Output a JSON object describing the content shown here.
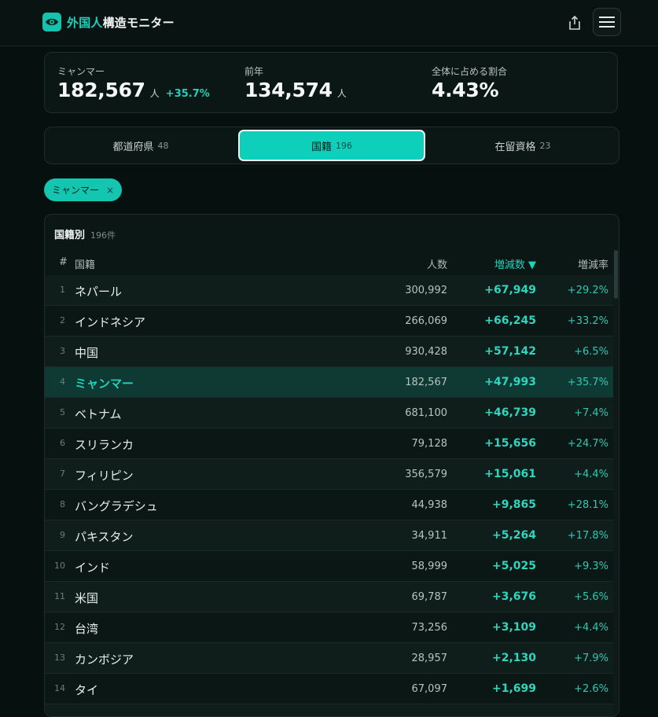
{
  "app": {
    "title_accent": "外国人",
    "title_rest": "構造モニター"
  },
  "header": {
    "share_icon": "share-icon",
    "menu_icon": "hamburger-menu-icon"
  },
  "stats": {
    "current": {
      "label": "ミャンマー",
      "value": "182,567",
      "unit": "人",
      "change": "+35.7%"
    },
    "previous": {
      "label": "前年",
      "value": "134,574",
      "unit": "人"
    },
    "share": {
      "label": "全体に占める割合",
      "value": "4.43%"
    }
  },
  "tabs": [
    {
      "label": "都道府県",
      "count": "48",
      "active": false
    },
    {
      "label": "国籍",
      "count": "196",
      "active": true
    },
    {
      "label": "在留資格",
      "count": "23",
      "active": false
    }
  ],
  "filter_chip": {
    "label": "ミャンマー",
    "close": "×"
  },
  "table": {
    "title": "国籍別",
    "count": "196件",
    "headers": {
      "rank": "#",
      "name": "国籍",
      "population": "人数",
      "delta": "増減数 ▼",
      "rate": "増減率"
    },
    "highlight_rank": "4",
    "rows": [
      {
        "rank": "1",
        "name": "ネパール",
        "population": "300,992",
        "delta": "+67,949",
        "rate": "+29.2%"
      },
      {
        "rank": "2",
        "name": "インドネシア",
        "population": "266,069",
        "delta": "+66,245",
        "rate": "+33.2%"
      },
      {
        "rank": "3",
        "name": "中国",
        "population": "930,428",
        "delta": "+57,142",
        "rate": "+6.5%"
      },
      {
        "rank": "4",
        "name": "ミャンマー",
        "population": "182,567",
        "delta": "+47,993",
        "rate": "+35.7%"
      },
      {
        "rank": "5",
        "name": "ベトナム",
        "population": "681,100",
        "delta": "+46,739",
        "rate": "+7.4%"
      },
      {
        "rank": "6",
        "name": "スリランカ",
        "population": "79,128",
        "delta": "+15,656",
        "rate": "+24.7%"
      },
      {
        "rank": "7",
        "name": "フィリピン",
        "population": "356,579",
        "delta": "+15,061",
        "rate": "+4.4%"
      },
      {
        "rank": "8",
        "name": "バングラデシュ",
        "population": "44,938",
        "delta": "+9,865",
        "rate": "+28.1%"
      },
      {
        "rank": "9",
        "name": "パキスタン",
        "population": "34,911",
        "delta": "+5,264",
        "rate": "+17.8%"
      },
      {
        "rank": "10",
        "name": "インド",
        "population": "58,999",
        "delta": "+5,025",
        "rate": "+9.3%"
      },
      {
        "rank": "11",
        "name": "米国",
        "population": "69,787",
        "delta": "+3,676",
        "rate": "+5.6%"
      },
      {
        "rank": "12",
        "name": "台湾",
        "population": "73,256",
        "delta": "+3,109",
        "rate": "+4.4%"
      },
      {
        "rank": "13",
        "name": "カンボジア",
        "population": "28,957",
        "delta": "+2,130",
        "rate": "+7.9%"
      },
      {
        "rank": "14",
        "name": "タイ",
        "population": "67,097",
        "delta": "+1,699",
        "rate": "+2.6%"
      },
      {
        "rank": "",
        "name": "",
        "population": "",
        "delta": "",
        "rate": ""
      }
    ]
  },
  "colors": {
    "accent": "#1ed3bd",
    "background": "#06100f",
    "panel": "#0b1715",
    "highlight_row": "#0f3a34"
  }
}
